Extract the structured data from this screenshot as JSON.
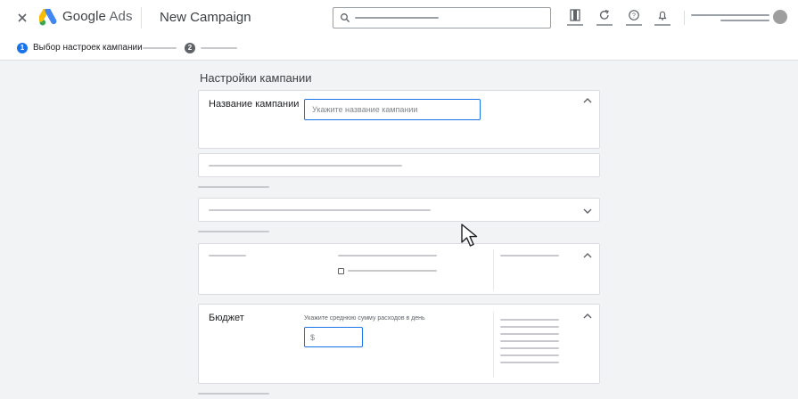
{
  "header": {
    "close_icon": "close-icon",
    "logo": "google-ads-logo",
    "product_name_google": "Google",
    "product_name_ads": "Ads",
    "page_title": "New Campaign",
    "search": {
      "placeholder": "",
      "value": ""
    },
    "tools": [
      "reports-icon",
      "refresh-icon",
      "help-icon",
      "notifications-icon"
    ]
  },
  "stepper": {
    "steps": [
      {
        "number": "1",
        "label": "Выбор настроек кампании",
        "active": true
      },
      {
        "number": "2",
        "label": "",
        "active": false
      }
    ]
  },
  "main": {
    "section_title": "Настройки кампании",
    "campaign_name": {
      "label": "Название кампании",
      "input_placeholder": "Укажите название кампании",
      "input_value": ""
    },
    "budget": {
      "label": "Бюджет",
      "hint": "Укажите среднюю сумму расходов в день",
      "input_placeholder": "$",
      "input_value": ""
    }
  },
  "colors": {
    "accent": "#1a73e8",
    "background": "#f1f3f4",
    "placeholder_line": "#c7c9cc",
    "logo_blue": "#4285f4",
    "logo_yellow": "#fbbc04",
    "logo_green": "#34a853"
  }
}
